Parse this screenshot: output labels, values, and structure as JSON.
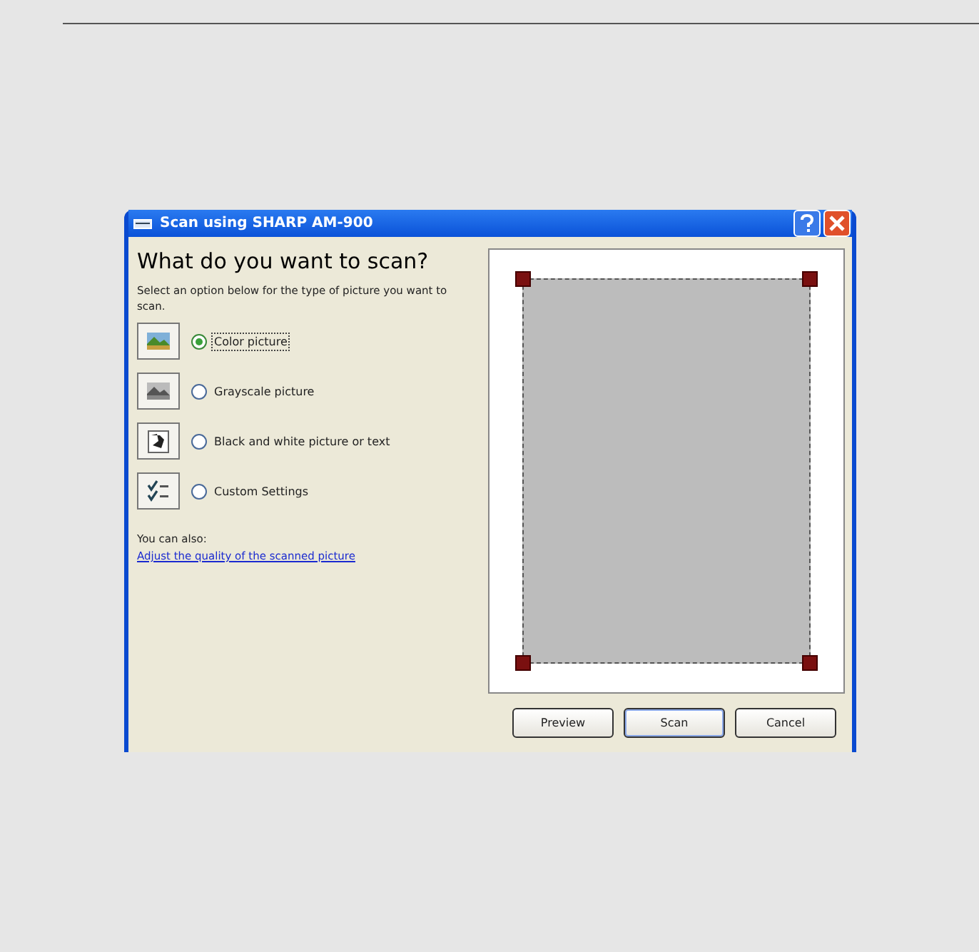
{
  "window": {
    "title": "Scan using SHARP AM-900"
  },
  "heading": "What do you want to scan?",
  "instructions": "Select an option below for the type of picture you want to scan.",
  "options": [
    {
      "kind": "color",
      "label": "Color picture",
      "selected": true
    },
    {
      "kind": "grayscale",
      "label": "Grayscale picture",
      "selected": false
    },
    {
      "kind": "bw",
      "label": "Black and white picture or text",
      "selected": false
    },
    {
      "kind": "custom",
      "label": "Custom Settings",
      "selected": false
    }
  ],
  "also_label": "You can also:",
  "link": "Adjust the quality of the scanned picture",
  "buttons": [
    {
      "label": "Preview",
      "default": false
    },
    {
      "label": "Scan",
      "default": true
    },
    {
      "label": "Cancel",
      "default": false
    }
  ]
}
